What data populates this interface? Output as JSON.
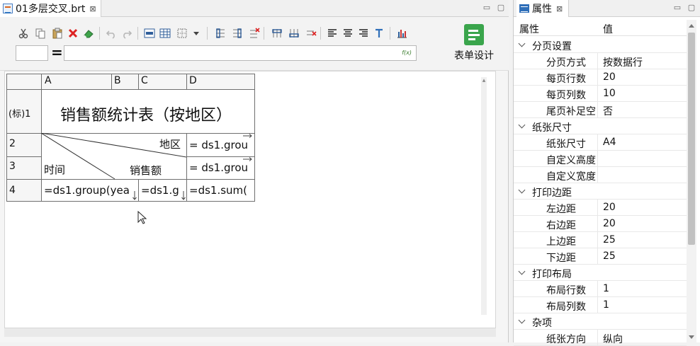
{
  "editor": {
    "tab_title": "01多层交叉.brt",
    "close_glyph": "⊠",
    "design_button_label": "表单设计",
    "fx_label": "f(x)",
    "equals_label": "=",
    "formula_value": "",
    "cellref_value": ""
  },
  "grid": {
    "col_headers": [
      "A",
      "B",
      "C",
      "D"
    ],
    "row_headers": [
      "(标)1",
      "2",
      "3",
      "4"
    ],
    "title": "销售额统计表（按地区）",
    "region_label": "地区",
    "time_label": "时间",
    "sales_label": "销售额",
    "d2": "= ds1.grou",
    "d3": "= ds1.grou",
    "a4": "=ds1.group(yea",
    "c4": "=ds1.g",
    "d4": "=ds1.sum("
  },
  "properties": {
    "tab_title": "属性",
    "col_name": "属性",
    "col_value": "值",
    "rows": [
      {
        "name": "分页设置",
        "value": "",
        "group": true
      },
      {
        "name": "分页方式",
        "value": "按数据行",
        "group": false
      },
      {
        "name": "每页行数",
        "value": "20",
        "group": false
      },
      {
        "name": "每页列数",
        "value": "10",
        "group": false
      },
      {
        "name": "尾页补足空",
        "value": "否",
        "group": false
      },
      {
        "name": "纸张尺寸",
        "value": "",
        "group": true
      },
      {
        "name": "纸张尺寸",
        "value": "A4",
        "group": false
      },
      {
        "name": "自定义高度",
        "value": "",
        "group": false
      },
      {
        "name": "自定义宽度",
        "value": "",
        "group": false
      },
      {
        "name": "打印边距",
        "value": "",
        "group": true
      },
      {
        "name": "左边距",
        "value": "20",
        "group": false
      },
      {
        "name": "右边距",
        "value": "20",
        "group": false
      },
      {
        "name": "上边距",
        "value": "25",
        "group": false
      },
      {
        "name": "下边距",
        "value": "25",
        "group": false
      },
      {
        "name": "打印布局",
        "value": "",
        "group": true
      },
      {
        "name": "布局行数",
        "value": "1",
        "group": false
      },
      {
        "name": "布局列数",
        "value": "1",
        "group": false
      },
      {
        "name": "杂项",
        "value": "",
        "group": true
      },
      {
        "name": "纸张方向",
        "value": "纵向",
        "group": false
      }
    ]
  }
}
